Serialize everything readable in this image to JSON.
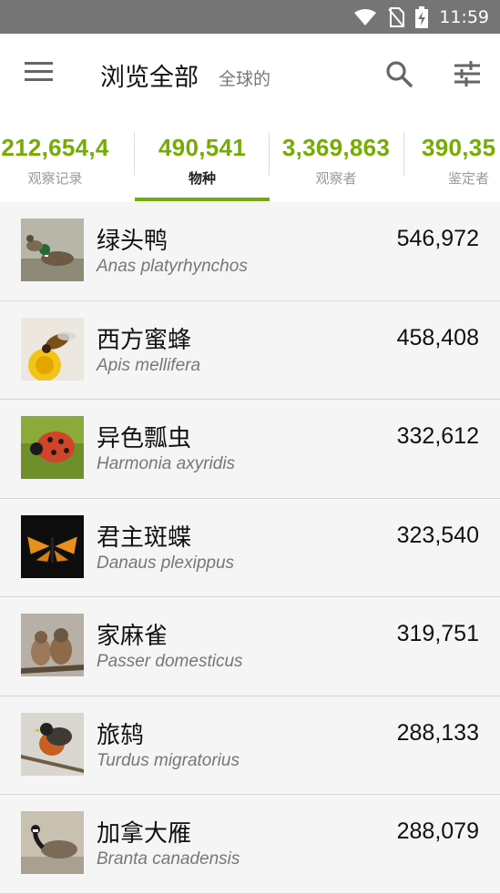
{
  "status_bar": {
    "time": "11:59"
  },
  "app_bar": {
    "title": "浏览全部",
    "subtitle": "全球的"
  },
  "stats": [
    {
      "value": "212,654,4",
      "label": "观察记录"
    },
    {
      "value": "490,541",
      "label": "物种"
    },
    {
      "value": "3,369,863",
      "label": "观察者"
    },
    {
      "value": "390,35",
      "label": "鉴定者"
    }
  ],
  "active_tab_label": "物种",
  "colors": {
    "accent": "#74ac00",
    "status_bar": "#757575"
  },
  "species": [
    {
      "common": "绿头鸭",
      "scientific": "Anas platyrhynchos",
      "count": "546,972"
    },
    {
      "common": "西方蜜蜂",
      "scientific": "Apis mellifera",
      "count": "458,408"
    },
    {
      "common": "异色瓢虫",
      "scientific": "Harmonia axyridis",
      "count": "332,612"
    },
    {
      "common": "君主斑蝶",
      "scientific": "Danaus plexippus",
      "count": "323,540"
    },
    {
      "common": "家麻雀",
      "scientific": "Passer domesticus",
      "count": "319,751"
    },
    {
      "common": "旅鸫",
      "scientific": "Turdus migratorius",
      "count": "288,133"
    },
    {
      "common": "加拿大雁",
      "scientific": "Branta canadensis",
      "count": "288,079"
    }
  ]
}
